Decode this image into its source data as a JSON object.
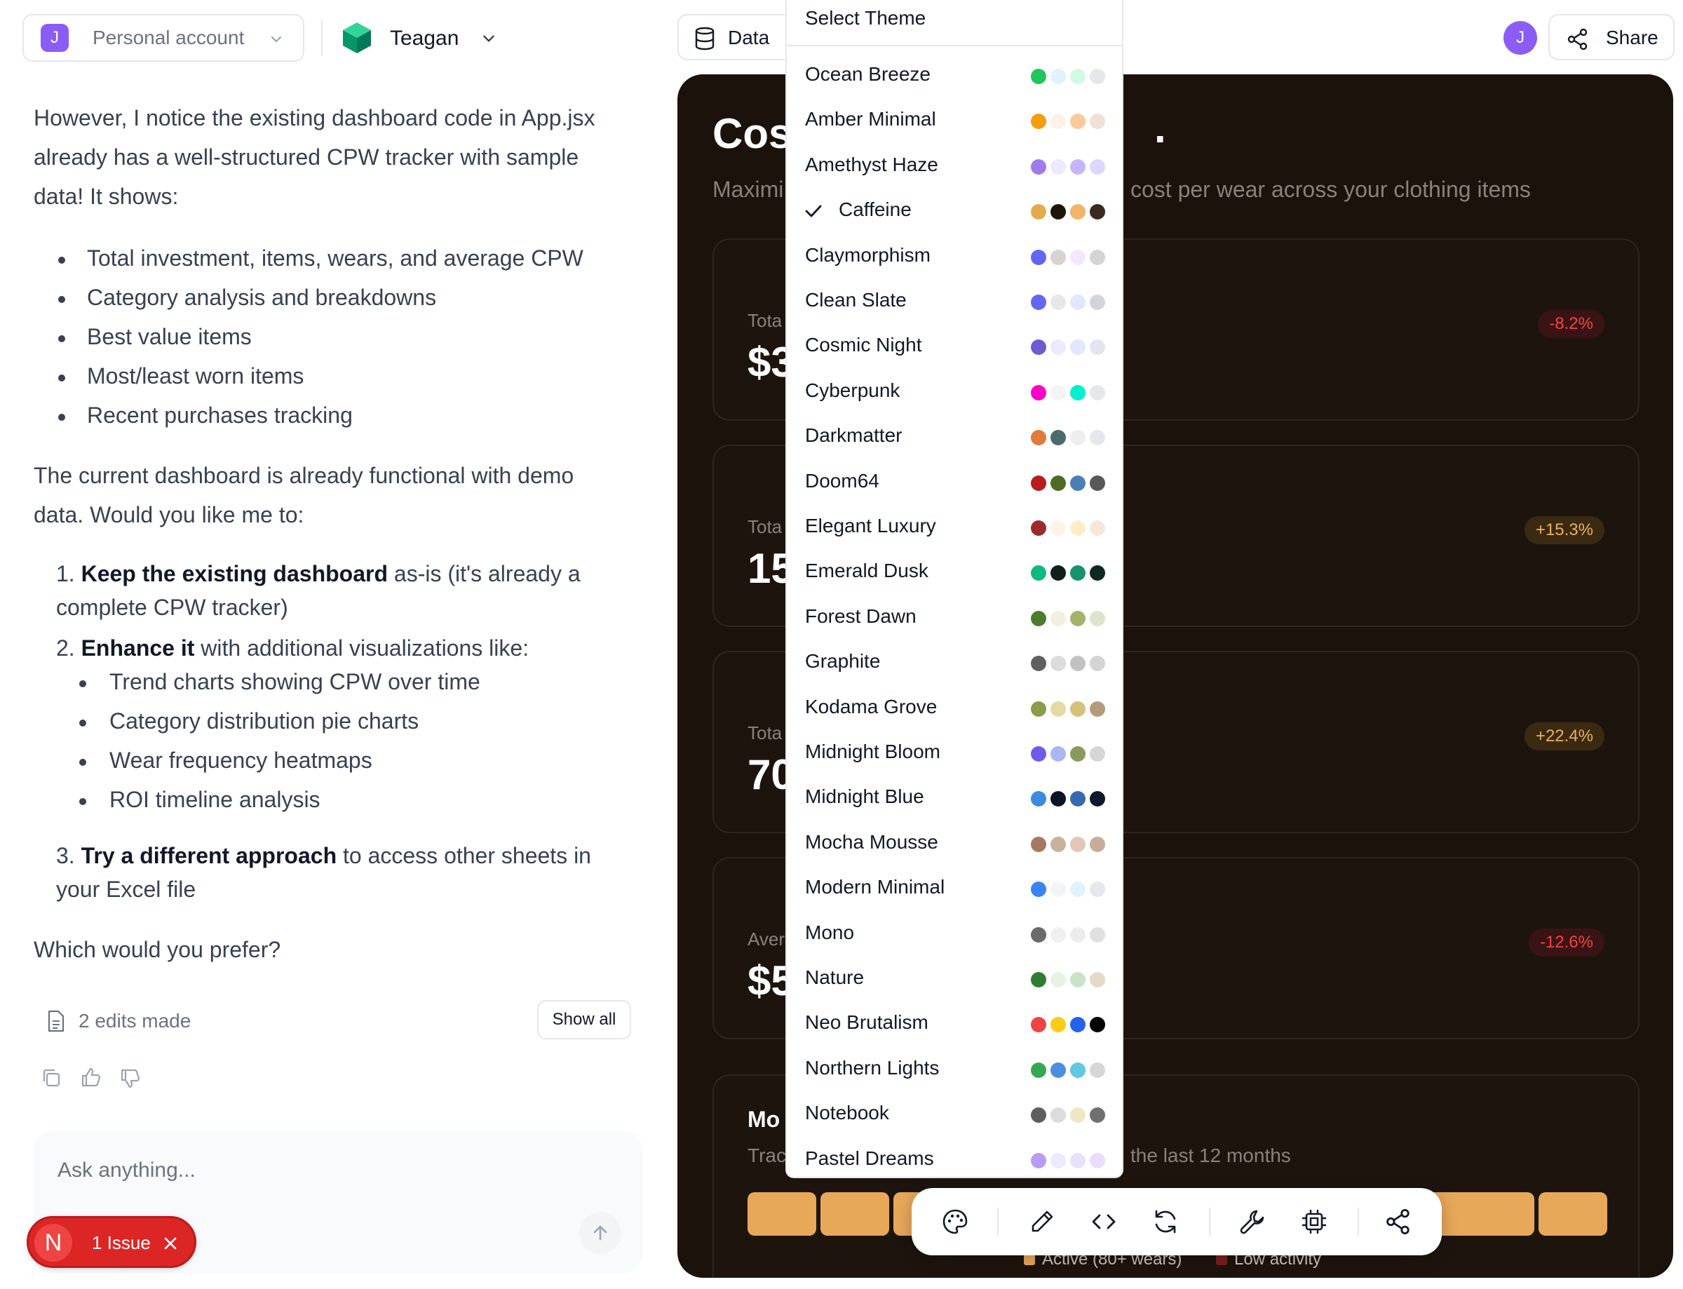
{
  "header": {
    "account_initial": "J",
    "account_label": "Personal account",
    "project_name": "Teagan",
    "data_label": "Data",
    "user_initial": "J",
    "share_label": "Share"
  },
  "chat": {
    "intro": [
      "However, I notice the existing dashboard code in App.jsx",
      "already has a well-structured CPW tracker with sample",
      "data! It shows:"
    ],
    "bullets": [
      "Total investment, items, wears, and average CPW",
      "Category analysis and breakdowns",
      "Best value items",
      "Most/least worn items",
      "Recent purchases tracking"
    ],
    "para2": [
      "The current dashboard is already functional with demo",
      "data. Would you like me to:"
    ],
    "opt1_num": "1.",
    "opt1_bold": "Keep the existing dashboard",
    "opt1_rest": " as-is (it's already a",
    "opt1_line2": "complete CPW tracker)",
    "opt2_num": "2.",
    "opt2_bold": "Enhance it",
    "opt2_rest": " with additional visualizations like:",
    "sub_bullets": [
      "Trend charts showing CPW over time",
      "Category distribution pie charts",
      "Wear frequency heatmaps",
      "ROI timeline analysis"
    ],
    "opt3_num": "3.",
    "opt3_bold": "Try a different approach",
    "opt3_rest": " to access other sheets in",
    "opt3_line2": "your Excel file",
    "question": "Which would you prefer?",
    "edits_label": "2 edits made",
    "show_all": "Show all",
    "input_placeholder": "Ask anything...",
    "issue_initial": "N",
    "issue_label": "1 Issue"
  },
  "preview": {
    "title": "Cos",
    "title_tail": ".",
    "subtitle_left": "Maximi",
    "subtitle_right": "cost per wear across your clothing items",
    "cards": [
      {
        "label": "Tota",
        "value": "$3",
        "change": "-8.2%",
        "trend": "neg"
      },
      {
        "label": "Tota",
        "value": "15",
        "change": "+15.3%",
        "trend": "pos"
      },
      {
        "label": "Tota",
        "value": "70",
        "change": "+22.4%",
        "trend": "pos"
      },
      {
        "label": "Aver",
        "value": "$5",
        "change": "-12.6%",
        "trend": "neg"
      }
    ],
    "section_title": "Mo",
    "section_sub_left": "Trac",
    "section_sub_right": "the last 12 months",
    "legend_active": "Active (80+ wears)",
    "legend_low": "Low activity"
  },
  "theme_menu": {
    "header": "Select Theme",
    "selected": "Caffeine",
    "themes": [
      {
        "name": "Ocean Breeze",
        "colors": [
          "#22c55e",
          "#e0f2fe",
          "#d1fae5",
          "#e5e7eb"
        ]
      },
      {
        "name": "Amber Minimal",
        "colors": [
          "#f59e0b",
          "#fdf0e6",
          "#fbc99b",
          "#f1e0d6"
        ]
      },
      {
        "name": "Amethyst Haze",
        "colors": [
          "#9f7aea",
          "#ede9fe",
          "#c4b5fd",
          "#ddd6fe"
        ]
      },
      {
        "name": "Caffeine",
        "colors": [
          "#e4a94d",
          "#1f140c",
          "#f2b36b",
          "#3a2a20"
        ]
      },
      {
        "name": "Claymorphism",
        "colors": [
          "#6366f1",
          "#d6d3d1",
          "#f3e8ff",
          "#d4d4d8"
        ]
      },
      {
        "name": "Clean Slate",
        "colors": [
          "#6366f1",
          "#e5e7eb",
          "#e0e7ff",
          "#d1d5db"
        ]
      },
      {
        "name": "Cosmic Night",
        "colors": [
          "#6d5bd0",
          "#ede9fe",
          "#e0e7ff",
          "#e4e4f0"
        ]
      },
      {
        "name": "Cyberpunk",
        "colors": [
          "#ff00c8",
          "#f3f4f6",
          "#00f0d0",
          "#e5e7eb"
        ]
      },
      {
        "name": "Darkmatter",
        "colors": [
          "#e07b39",
          "#4a6b6b",
          "#eeeeee",
          "#e5e7eb"
        ]
      },
      {
        "name": "Doom64",
        "colors": [
          "#b91c1c",
          "#4d6b24",
          "#4a7fb5",
          "#595959"
        ]
      },
      {
        "name": "Elegant Luxury",
        "colors": [
          "#9b2c2c",
          "#fdf3e7",
          "#fcefc7",
          "#f6e7d8"
        ]
      },
      {
        "name": "Emerald Dusk",
        "colors": [
          "#10b981",
          "#0f1f1a",
          "#15946b",
          "#0d2a22"
        ]
      },
      {
        "name": "Forest Dawn",
        "colors": [
          "#4d7c2f",
          "#f1efe2",
          "#a3b36b",
          "#dde3cc"
        ]
      },
      {
        "name": "Graphite",
        "colors": [
          "#606060",
          "#dcdcdc",
          "#c2c2c2",
          "#d4d4d4"
        ]
      },
      {
        "name": "Kodama Grove",
        "colors": [
          "#8d9b4c",
          "#e5d9a7",
          "#d4c17a",
          "#b59b7c"
        ]
      },
      {
        "name": "Midnight Bloom",
        "colors": [
          "#6d5ce8",
          "#a8b8f0",
          "#8a9a5b",
          "#d6d6d6"
        ]
      },
      {
        "name": "Midnight Blue",
        "colors": [
          "#3b8be0",
          "#0b1526",
          "#3669b0",
          "#0c1a2b"
        ]
      },
      {
        "name": "Mocha Mousse",
        "colors": [
          "#a57864",
          "#c7b39a",
          "#e2c7b8",
          "#c7ad97"
        ]
      },
      {
        "name": "Modern Minimal",
        "colors": [
          "#3b82f6",
          "#f3f4f6",
          "#e0f2fe",
          "#e5e7eb"
        ]
      },
      {
        "name": "Mono",
        "colors": [
          "#6b6b6b",
          "#f0f0f0",
          "#ececec",
          "#e0e0e0"
        ]
      },
      {
        "name": "Nature",
        "colors": [
          "#2e7d32",
          "#e6f2e6",
          "#c9e3c9",
          "#e6d9c9"
        ]
      },
      {
        "name": "Neo Brutalism",
        "colors": [
          "#ef4444",
          "#facc15",
          "#2563eb",
          "#000000"
        ]
      },
      {
        "name": "Northern Lights",
        "colors": [
          "#34a853",
          "#4a8fe0",
          "#62c7e0",
          "#d6d6d6"
        ]
      },
      {
        "name": "Notebook",
        "colors": [
          "#5e5e5e",
          "#dcdcdc",
          "#f0e6c2",
          "#707070"
        ]
      },
      {
        "name": "Pastel Dreams",
        "colors": [
          "#b79cf5",
          "#ede9fe",
          "#e9e1fb",
          "#e8ddfd"
        ]
      }
    ]
  },
  "toolbar": {
    "icons": [
      "palette-icon",
      "pencil-icon",
      "code-icon",
      "refresh-icon",
      "wrench-icon",
      "chip-icon",
      "share-icon"
    ]
  },
  "colors": {
    "accent": "#8b5cf6",
    "preview_bg": "#1a120b",
    "bar": "#e8a85a",
    "issue_red": "#dc2626"
  }
}
